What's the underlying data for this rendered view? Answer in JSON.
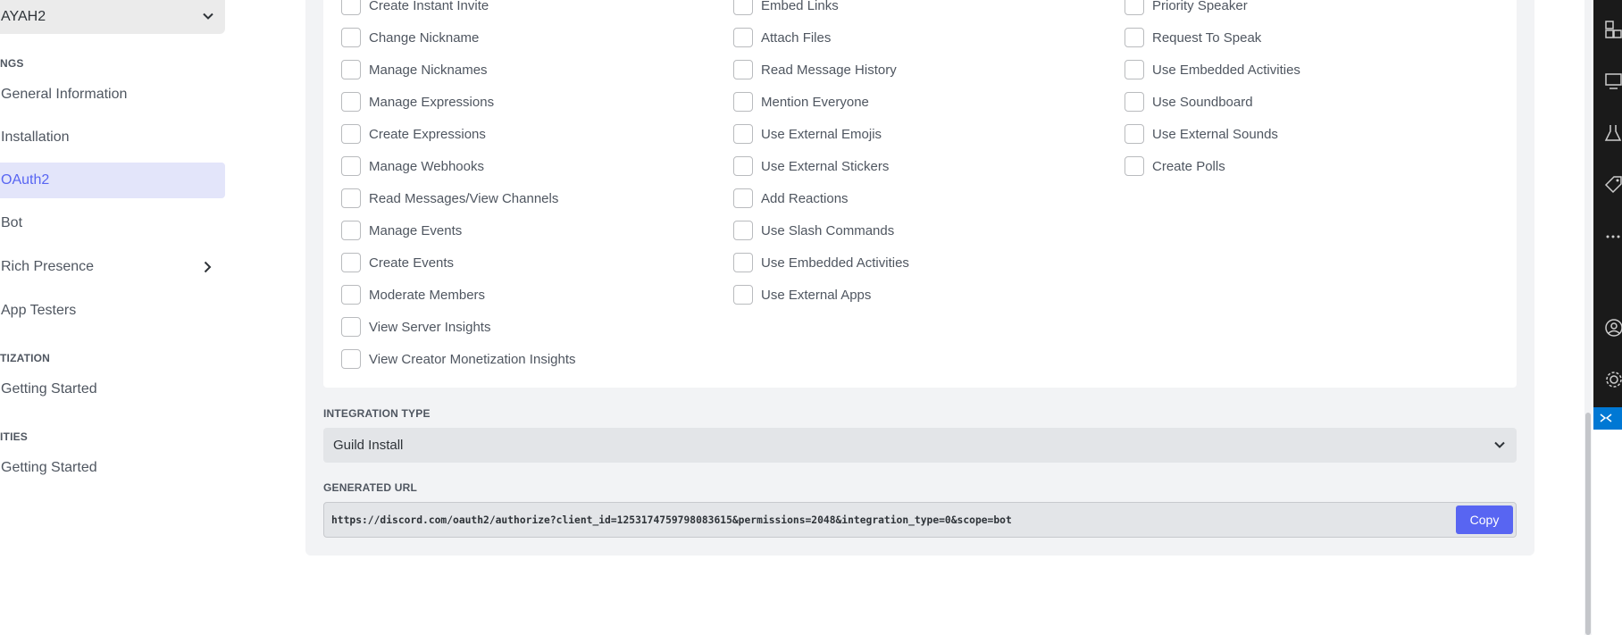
{
  "sidebar": {
    "app_name": "AYAH2",
    "sections": [
      {
        "heading": "NGS",
        "items": [
          {
            "label": "General Information"
          },
          {
            "label": "Installation"
          },
          {
            "label": "OAuth2",
            "active": true
          },
          {
            "label": "Bot"
          },
          {
            "label": "Rich Presence",
            "has_submenu": true
          },
          {
            "label": "App Testers"
          }
        ]
      },
      {
        "heading": "TIZATION",
        "items": [
          {
            "label": "Getting Started"
          }
        ]
      },
      {
        "heading": "ITIES",
        "items": [
          {
            "label": "Getting Started"
          }
        ]
      }
    ]
  },
  "permissions": {
    "col1": [
      "Create Instant Invite",
      "Change Nickname",
      "Manage Nicknames",
      "Manage Expressions",
      "Create Expressions",
      "Manage Webhooks",
      "Read Messages/View Channels",
      "Manage Events",
      "Create Events",
      "Moderate Members",
      "View Server Insights",
      "View Creator Monetization Insights"
    ],
    "col2": [
      "Embed Links",
      "Attach Files",
      "Read Message History",
      "Mention Everyone",
      "Use External Emojis",
      "Use External Stickers",
      "Add Reactions",
      "Use Slash Commands",
      "Use Embedded Activities",
      "Use External Apps"
    ],
    "col3": [
      "Priority Speaker",
      "Request To Speak",
      "Use Embedded Activities",
      "Use Soundboard",
      "Use External Sounds",
      "Create Polls"
    ]
  },
  "integration": {
    "label": "INTEGRATION TYPE",
    "value": "Guild Install"
  },
  "generated": {
    "label": "GENERATED URL",
    "url": "https://discord.com/oauth2/authorize?client_id=1253174759798083615&permissions=2048&integration_type=0&scope=bot",
    "copy_label": "Copy"
  },
  "colors": {
    "accent": "#5865f2",
    "active_nav_bg": "#e3e5fa",
    "vscode_blue": "#0078d4"
  },
  "right_strip_icons": [
    "extensions-icon",
    "remote-explorer-icon",
    "testing-icon",
    "tag-icon",
    "more-icon",
    "account-icon",
    "settings-gear-icon",
    "remote-connection-icon"
  ]
}
